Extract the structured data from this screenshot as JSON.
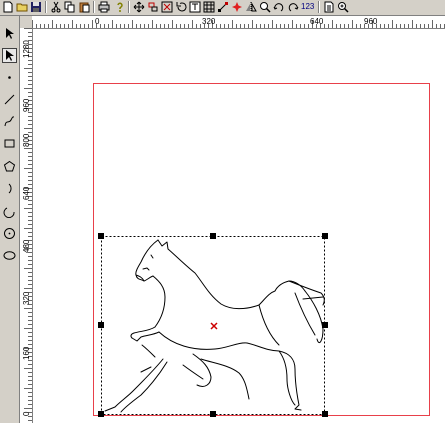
{
  "toolbar": {
    "icons": [
      "new-file-icon",
      "open-folder-icon",
      "save-icon",
      "cut-icon",
      "copy-icon",
      "paste-icon",
      "print-icon",
      "help-icon",
      "move-icon",
      "align-icon",
      "delete-node-icon",
      "undo-icon",
      "text-icon",
      "grid-icon",
      "node-icon",
      "center-point-icon",
      "mirror-icon",
      "zoom-icon",
      "rotate-icon",
      "rotate-cw-icon",
      "number-text-icon",
      "page-icon",
      "zoom-fit-icon"
    ],
    "number_label": "123"
  },
  "tools": [
    "select-arrow",
    "node-edit",
    "point",
    "line",
    "curve",
    "rectangle",
    "polygon",
    "arc",
    "spiral",
    "circle-center",
    "ellipse"
  ],
  "ruler": {
    "h_labels": [
      "0",
      "320",
      "640",
      "960"
    ],
    "v_labels": [
      "1280",
      "960",
      "800",
      "640",
      "480",
      "320",
      "160",
      "0"
    ]
  },
  "colors": {
    "page_border": "#e8404a",
    "center_marker": "#cc0000",
    "selection_handles": "#000000"
  }
}
